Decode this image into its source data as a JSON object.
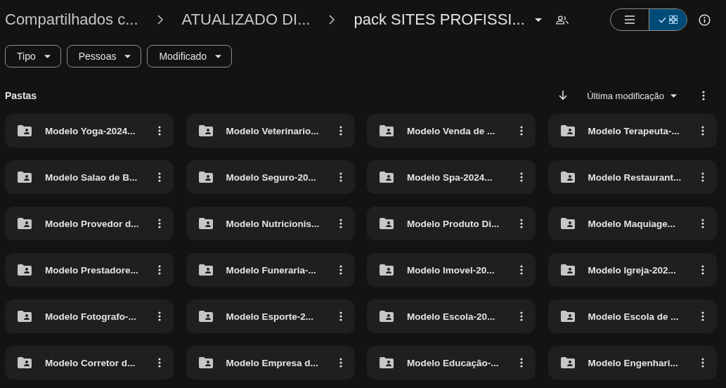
{
  "breadcrumbs": [
    {
      "label": "Compartilhados c...",
      "current": false
    },
    {
      "label": "ATUALIZADO DI...",
      "current": false
    },
    {
      "label": "pack SITES PROFISSI...",
      "current": true
    }
  ],
  "view_toggle": [
    {
      "kind": "list",
      "selected": false
    },
    {
      "kind": "grid",
      "selected": true
    }
  ],
  "filters": [
    {
      "label": "Tipo"
    },
    {
      "label": "Pessoas"
    },
    {
      "label": "Modificado"
    }
  ],
  "section": {
    "title": "Pastas",
    "sort": "Última modificação"
  },
  "folders": [
    {
      "name": "Modelo Yoga-2024..."
    },
    {
      "name": "Modelo Veterinario..."
    },
    {
      "name": "Modelo Venda de ..."
    },
    {
      "name": "Modelo Terapeuta-..."
    },
    {
      "name": "Modelo Salao de B..."
    },
    {
      "name": "Modelo Seguro-20..."
    },
    {
      "name": "Modelo Spa-2024..."
    },
    {
      "name": "Modelo Restaurant..."
    },
    {
      "name": "Modelo Provedor d..."
    },
    {
      "name": "Modelo Nutricionis..."
    },
    {
      "name": "Modelo Produto Di..."
    },
    {
      "name": "Modelo Maquiage..."
    },
    {
      "name": "Modelo Prestadore..."
    },
    {
      "name": "Modelo Funeraria-..."
    },
    {
      "name": "Modelo Imovel-20..."
    },
    {
      "name": "Modelo Igreja-202..."
    },
    {
      "name": "Modelo Fotografo-..."
    },
    {
      "name": "Modelo Esporte-2..."
    },
    {
      "name": "Modelo Escola-20..."
    },
    {
      "name": "Modelo Escola de ..."
    },
    {
      "name": "Modelo Corretor d..."
    },
    {
      "name": "Modelo Empresa d..."
    },
    {
      "name": "Modelo Educação-..."
    },
    {
      "name": "Modelo Engenhari..."
    }
  ]
}
